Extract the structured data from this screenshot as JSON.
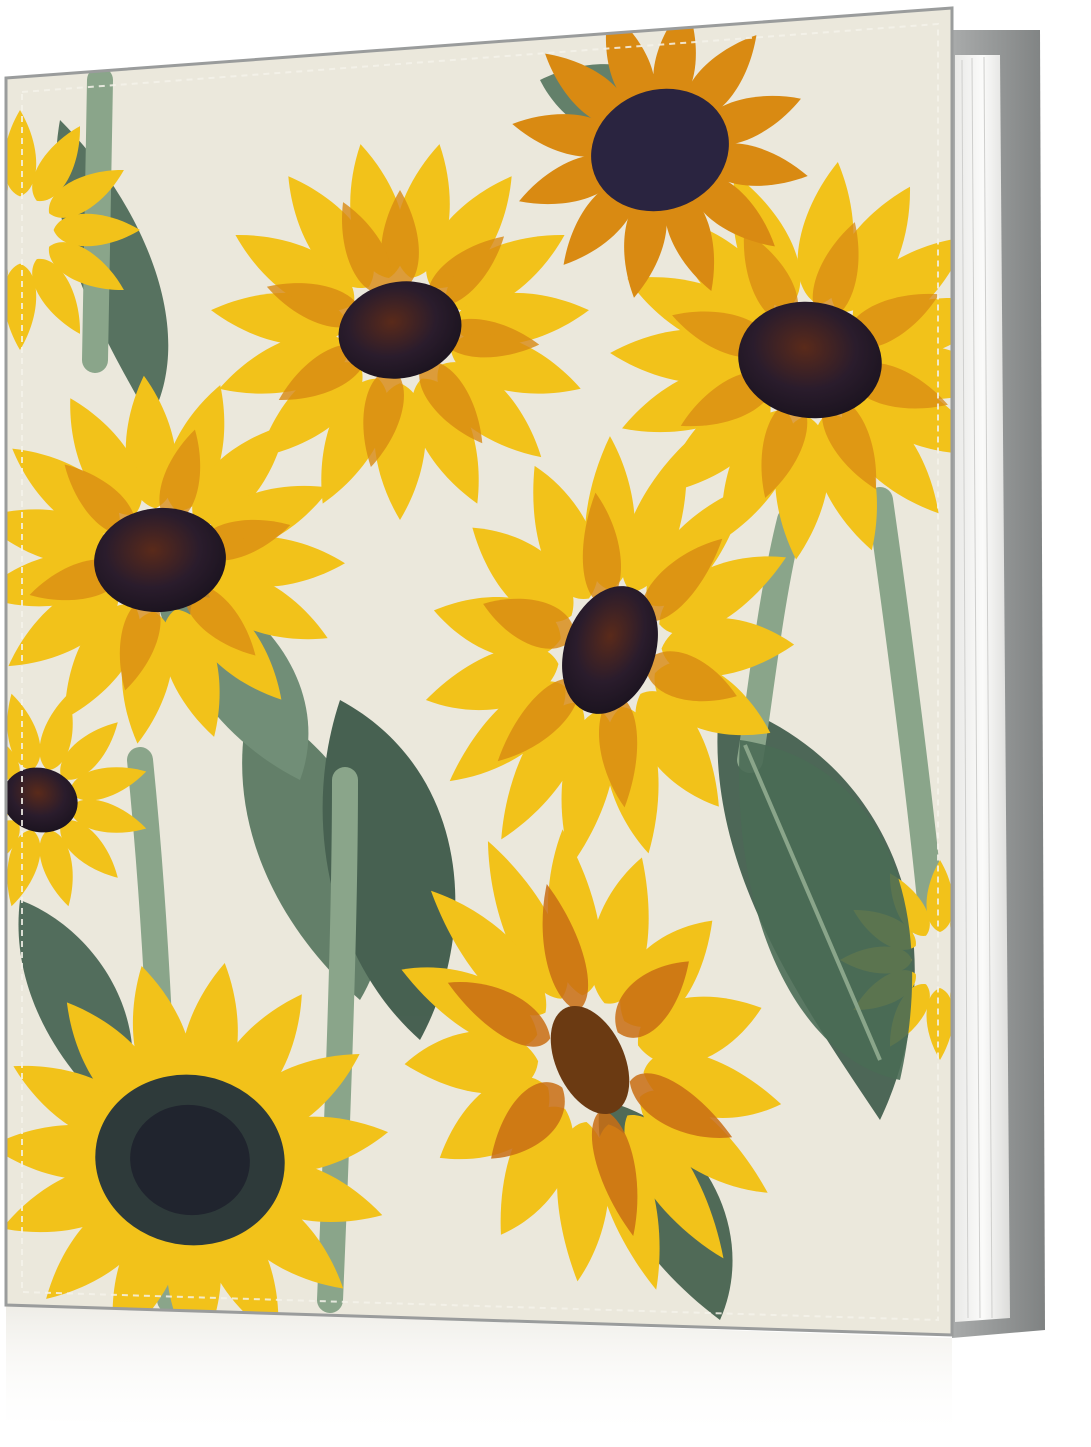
{
  "product": {
    "kind": "photo-album",
    "cover_pattern": "sunflowers",
    "spine_color": "#9a9c9c",
    "page_edge_color": "#f4f4f2",
    "cover_background": "#ebe8dc",
    "petal_color": "#f2c21a",
    "petal_shadow": "#d98a12",
    "seed_center": "#2a1c2c",
    "leaf_color": "#4f6b58",
    "stem_color": "#8aa58a",
    "flower_icon": "sunflower-icon",
    "leaf_icon": "leaf-icon"
  }
}
